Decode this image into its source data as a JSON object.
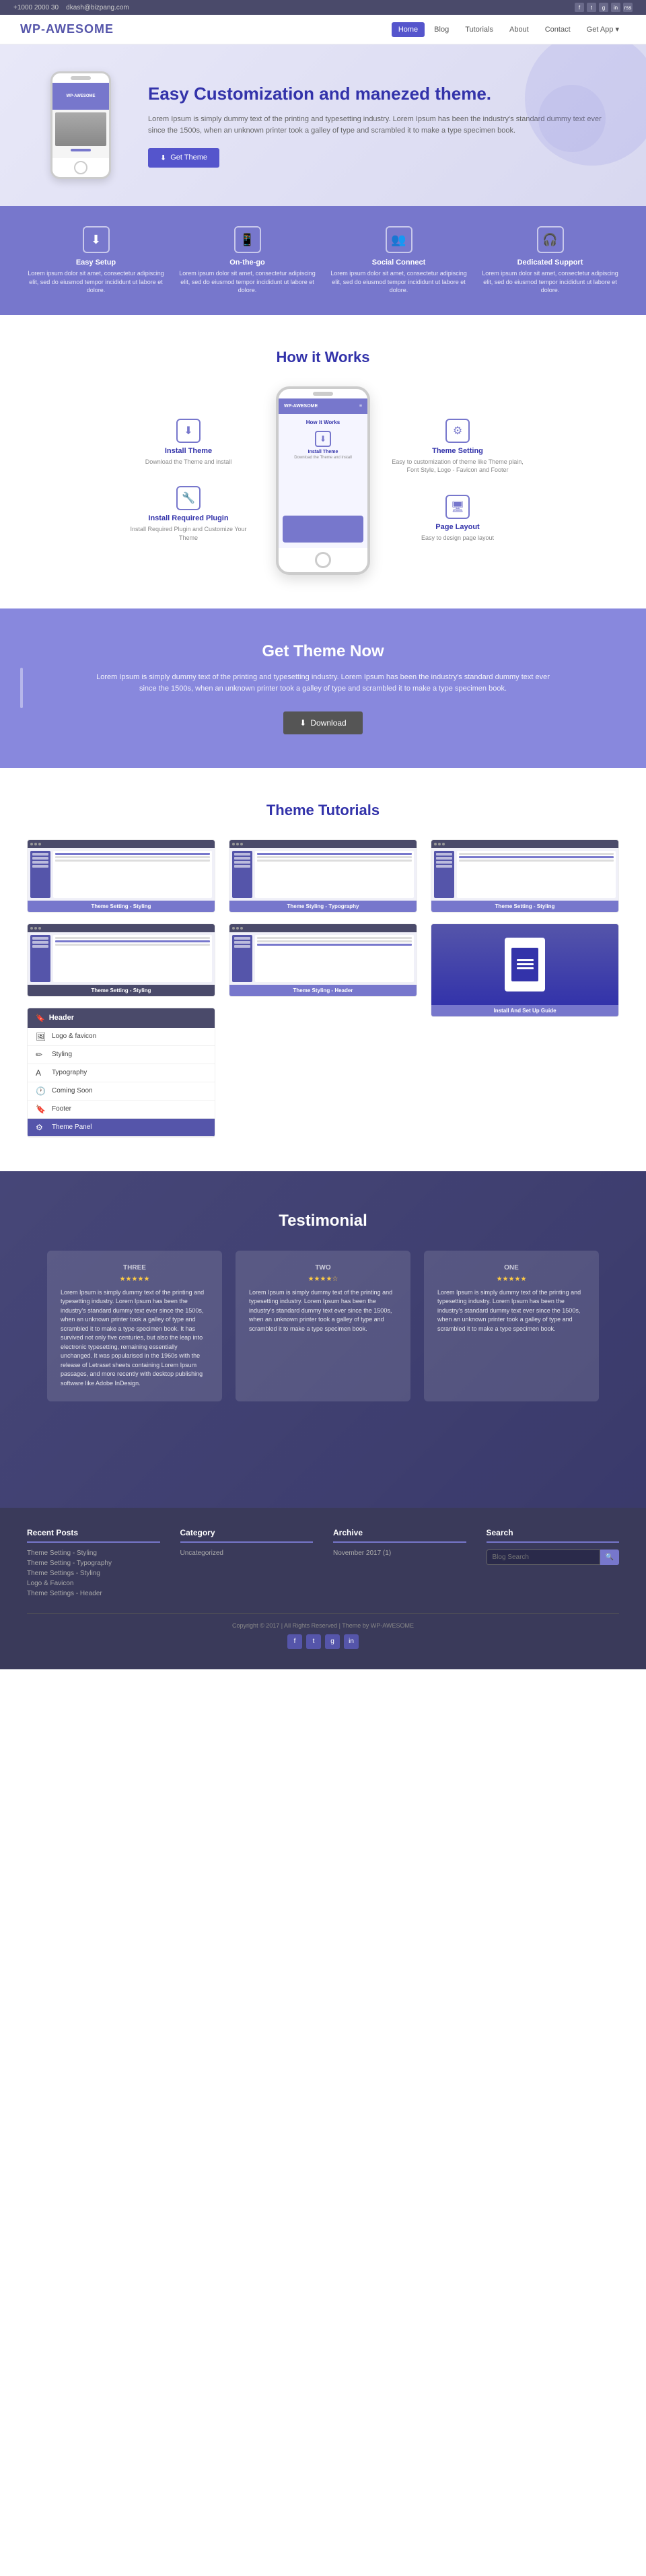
{
  "topbar": {
    "phone": "+1000 2000 30",
    "email": "dkash@bizpang.com",
    "icons": [
      "f",
      "t",
      "g",
      "in",
      "rss"
    ]
  },
  "nav": {
    "logo": "WP-AWESOME",
    "links": [
      {
        "label": "Home",
        "active": true
      },
      {
        "label": "Blog",
        "active": false
      },
      {
        "label": "Tutorials",
        "active": false
      },
      {
        "label": "About",
        "active": false
      },
      {
        "label": "Contact",
        "active": false
      },
      {
        "label": "Get App ▾",
        "active": false
      }
    ]
  },
  "hero": {
    "title": "Easy Customization and manezed theme.",
    "description": "Lorem Ipsum is simply dummy text of the printing and typesetting industry. Lorem Ipsum has been the industry's standard dummy text ever since the 1500s, when an unknown printer took a galley of type and scrambled it to make a type specimen book.",
    "button": "Get Theme"
  },
  "features": [
    {
      "icon": "⬇",
      "title": "Easy Setup",
      "description": "Lorem ipsum dolor sit amet, consectetur adipiscing elit, sed do eiusmod tempor incididunt ut labore et dolore."
    },
    {
      "icon": "📱",
      "title": "On-the-go",
      "description": "Lorem ipsum dolor sit amet, consectetur adipiscing elit, sed do eiusmod tempor incididunt ut labore et dolore."
    },
    {
      "icon": "👥",
      "title": "Social Connect",
      "description": "Lorem ipsum dolor sit amet, consectetur adipiscing elit, sed do eiusmod tempor incididunt ut labore et dolore."
    },
    {
      "icon": "🎧",
      "title": "Dedicated Support",
      "description": "Lorem ipsum dolor sit amet, consectetur adipiscing elit, sed do eiusmod tempor incididunt ut labore et dolore."
    }
  ],
  "howItWorks": {
    "title": "How it Works",
    "leftItems": [
      {
        "icon": "⬇",
        "title": "Install Theme",
        "description": "Download the Theme and install"
      },
      {
        "icon": "🔧",
        "title": "Install Required Plugin",
        "description": "Install Required Plugin and Customize Your Theme"
      }
    ],
    "rightItems": [
      {
        "icon": "⚙",
        "title": "Theme Setting",
        "description": "Easy to customization of theme like Theme plain, Font Style, Logo - Favicon and Footer"
      },
      {
        "icon": "🖥",
        "title": "Page Layout",
        "description": "Easy to design page layout"
      }
    ],
    "phoneHeader": "WP-AWESOME",
    "phoneTitle": "How it Works",
    "phoneSubIcon": "⬇",
    "phoneSubTitle": "Install Theme",
    "phoneSubDesc": "Download the Theme and install"
  },
  "getThemeNow": {
    "title": "Get Theme Now",
    "description": "Lorem Ipsum is simply dummy text of the printing and typesetting industry. Lorem Ipsum has been the industry's standard dummy text ever since the 1500s, when an unknown printer took a galley of type and scrambled it to make a type specimen book.",
    "button": "Download"
  },
  "themeTutorials": {
    "title": "Theme Tutorials",
    "col1": [
      {
        "label": "Theme Setting - Styling"
      },
      {
        "label": "Theme Setting - Styling"
      }
    ],
    "col2": [
      {
        "label": "Theme Styling - Typography"
      },
      {
        "label": "Theme Styling - Header"
      }
    ],
    "col3": [
      {
        "label": "Theme Setting - Styling"
      },
      {
        "label": "Install And Set Up Guide"
      }
    ],
    "sidebarMenu": {
      "header": "Header",
      "items": [
        {
          "icon": "🖼",
          "label": "Logo & favicon"
        },
        {
          "icon": "✏",
          "label": "Styling"
        },
        {
          "icon": "A",
          "label": "Typography"
        },
        {
          "icon": "🕐",
          "label": "Coming Soon"
        },
        {
          "icon": "🔖",
          "label": "Footer"
        },
        {
          "icon": "⚙",
          "label": "Theme Panel"
        }
      ]
    }
  },
  "testimonial": {
    "title": "Testimonial",
    "cards": [
      {
        "number": "THREE",
        "stars": "★★★★★",
        "text": "Lorem Ipsum is simply dummy text of the printing and typesetting industry. Lorem Ipsum has been the industry's standard dummy text ever since the 1500s, when an unknown printer took a galley of type and scrambled it to make a type specimen book. It has survived not only five centuries, but also the leap into electronic typesetting, remaining essentially unchanged. It was popularised in the 1960s with the release of Letraset sheets containing Lorem Ipsum passages, and more recently with desktop publishing software like Adobe InDesign."
      },
      {
        "number": "TWO",
        "stars": "★★★★☆",
        "text": "Lorem Ipsum is simply dummy text of the printing and typesetting industry. Lorem Ipsum has been the industry's standard dummy text ever since the 1500s, when an unknown printer took a galley of type and scrambled it to make a type specimen book."
      },
      {
        "number": "ONE",
        "stars": "★★★★★",
        "text": "Lorem Ipsum is simply dummy text of the printing and typesetting industry. Lorem Ipsum has been the industry's standard dummy text ever since the 1500s, when an unknown printer took a galley of type and scrambled it to make a type specimen book."
      }
    ]
  },
  "footer": {
    "cols": [
      {
        "title": "Recent Posts",
        "links": [
          "Theme Setting - Styling",
          "Theme Setting - Typography",
          "Theme Settings - Styling",
          "Logo & Favicon",
          "Theme Settings - Header"
        ]
      },
      {
        "title": "Category",
        "links": [
          "Uncategorized"
        ]
      },
      {
        "title": "Archive",
        "links": [
          "November 2017 (1)"
        ]
      },
      {
        "title": "Search",
        "search_placeholder": "Blog Search",
        "search_button": "🔍"
      }
    ],
    "bottom": "Copyright © 2017 | All Rights Reserved | Theme by WP-AWESOME",
    "social": [
      "f",
      "t",
      "g",
      "in"
    ]
  }
}
